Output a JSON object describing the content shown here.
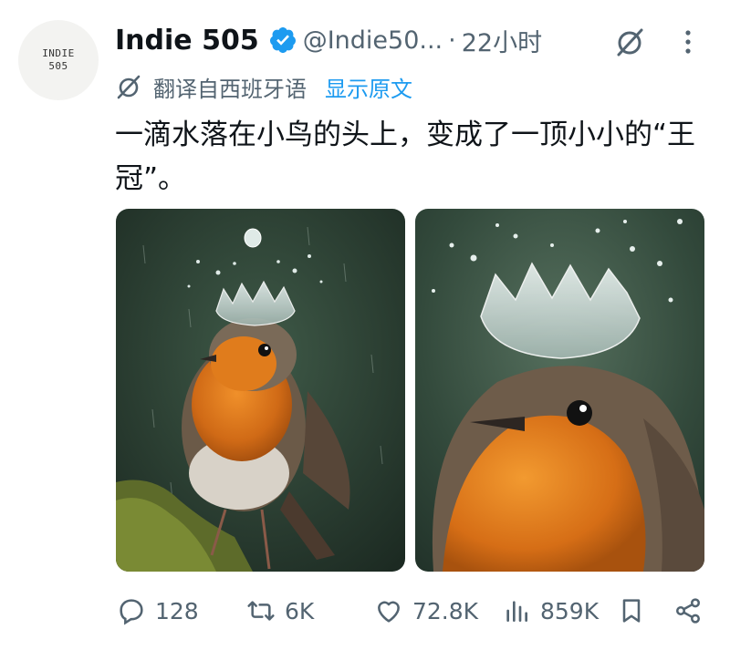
{
  "author": {
    "avatar_text_line1": "INDIE",
    "avatar_text_line2": "505",
    "name": "Indie 505",
    "handle": "@Indie50...",
    "separator": "·",
    "time": "22小时"
  },
  "translation": {
    "label": "翻译自西班牙语",
    "show_original": "显示原文"
  },
  "tweet": {
    "text": "一滴水落在小鸟的头上，变成了一顶小小的“王冠”。"
  },
  "stats": {
    "replies": "128",
    "retweets": "6K",
    "likes": "72.8K",
    "views": "859K"
  },
  "colors": {
    "accent": "#1d9bf0",
    "secondary_text": "#536471",
    "primary_text": "#0f1419"
  },
  "icons": {
    "verified": "verified-badge-icon",
    "grok": "grok-icon",
    "more": "more-options-icon",
    "translate": "translate-icon",
    "reply": "reply-icon",
    "retweet": "retweet-icon",
    "like": "like-icon",
    "views": "views-icon",
    "bookmark": "bookmark-icon",
    "share": "share-icon"
  }
}
